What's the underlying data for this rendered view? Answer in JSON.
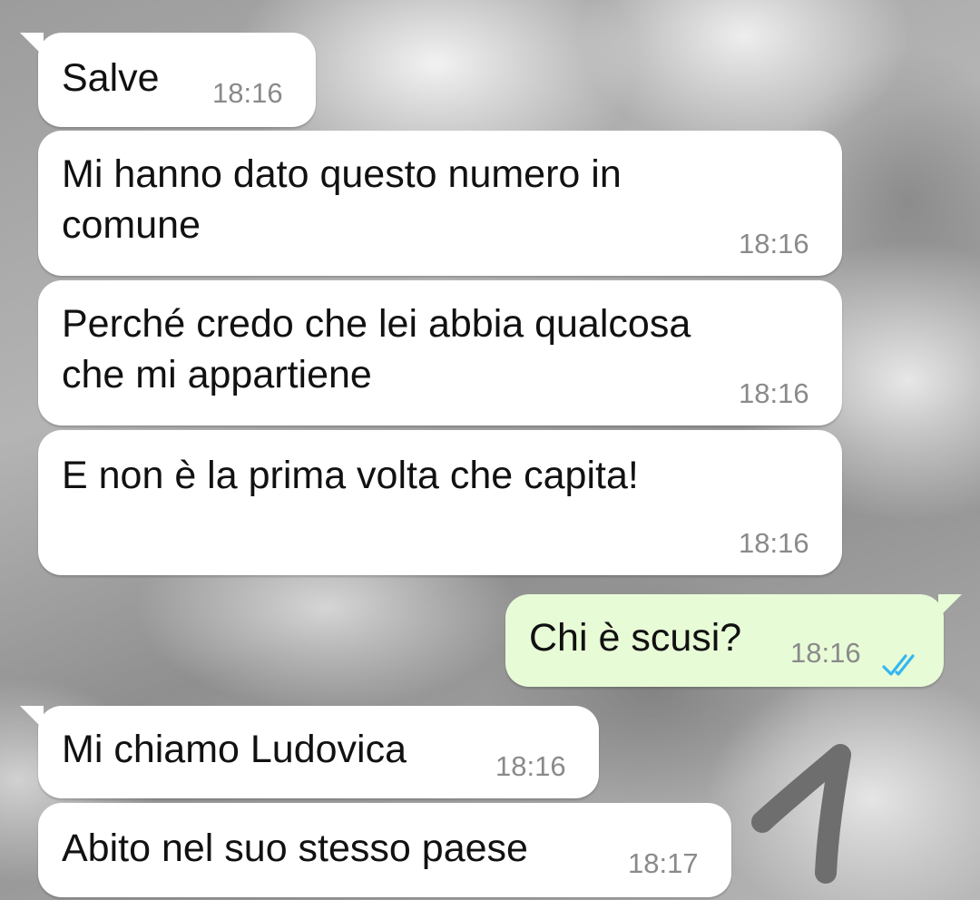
{
  "messages": [
    {
      "text": "Salve",
      "time": "18:16",
      "direction": "incoming"
    },
    {
      "text_lines": [
        "Mi hanno dato questo numero in",
        "comune"
      ],
      "time": "18:16",
      "direction": "incoming"
    },
    {
      "text_lines": [
        "Perché credo che lei abbia qualcosa",
        "che mi appartiene"
      ],
      "time": "18:16",
      "direction": "incoming"
    },
    {
      "text": "E non è la prima volta che capita!",
      "time": "18:16",
      "direction": "incoming"
    },
    {
      "text": "Chi è scusi?",
      "time": "18:16",
      "direction": "outgoing",
      "status": "read",
      "status_icon": "double-check-icon",
      "status_color": "#34b7f1"
    },
    {
      "text": "Mi chiamo Ludovica",
      "time": "18:16",
      "direction": "incoming"
    },
    {
      "text": "Abito nel suo stesso paese",
      "time": "18:17",
      "direction": "incoming"
    }
  ],
  "colors": {
    "incoming_bubble": "#ffffff",
    "outgoing_bubble": "#e8fbd7",
    "timestamp": "#8a8a8a",
    "read_ticks": "#34b7f1",
    "annotation_mark": "#6e6e6e"
  },
  "annotation": {
    "icon": "number-one-mark-icon"
  }
}
